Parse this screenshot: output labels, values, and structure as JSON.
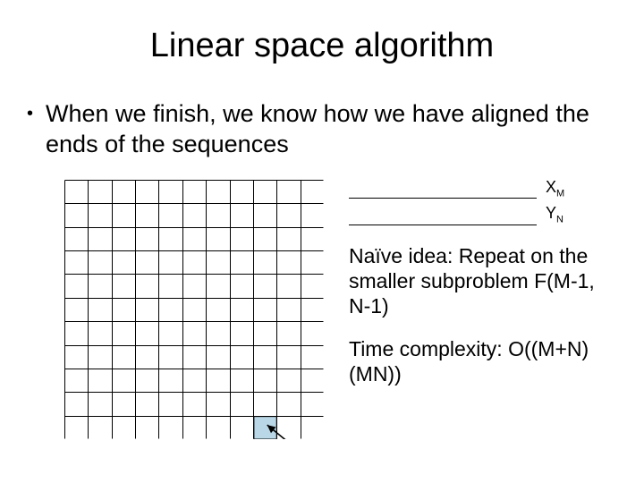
{
  "title": "Linear space algorithm",
  "bullet": "When we finish, we know how we have aligned the ends of the sequences",
  "seq1": {
    "var": "X",
    "sub": "M"
  },
  "seq2": {
    "var": "Y",
    "sub": "N"
  },
  "para1": "Naïve idea: Repeat on the smaller subproblem F(M-1, N-1)",
  "para2": "Time complexity: O((M+N)(MN))",
  "grid": {
    "cols": 11,
    "rows": 11
  }
}
